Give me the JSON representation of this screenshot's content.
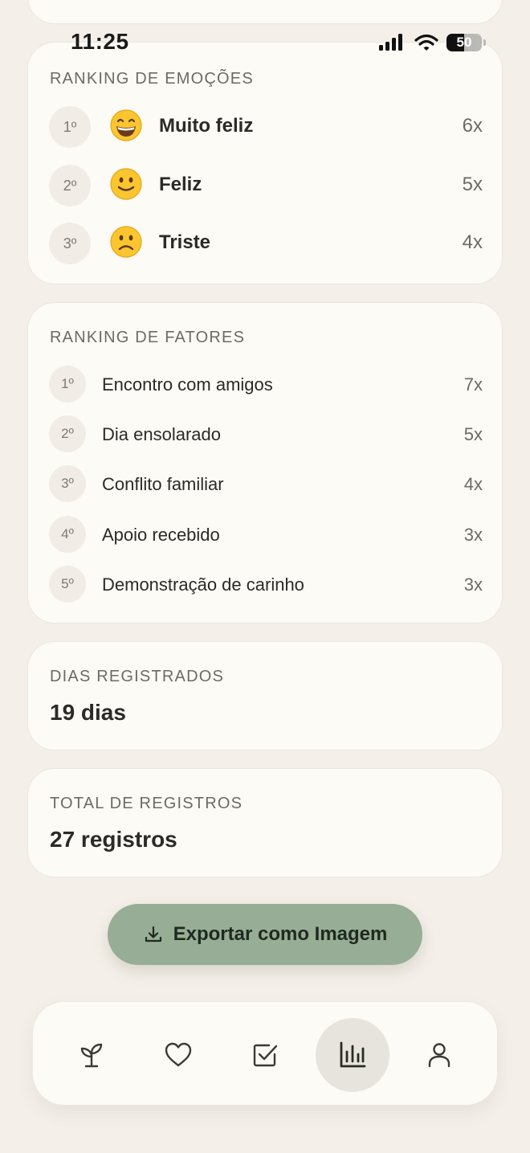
{
  "status_bar": {
    "time": "11:25",
    "battery_level": 50,
    "battery_text": "50",
    "icons": [
      "signal-icon",
      "wifi-icon",
      "battery-icon"
    ]
  },
  "emotions_card": {
    "title": "RANKING DE EMOÇÕES",
    "items": [
      {
        "rank": "1º",
        "emoji": "grinning-face",
        "label": "Muito feliz",
        "count": "6x"
      },
      {
        "rank": "2º",
        "emoji": "slightly-smiling-face",
        "label": "Feliz",
        "count": "5x"
      },
      {
        "rank": "3º",
        "emoji": "slightly-frowning-face",
        "label": "Triste",
        "count": "4x"
      }
    ]
  },
  "factors_card": {
    "title": "RANKING DE FATORES",
    "items": [
      {
        "rank": "1º",
        "label": "Encontro com amigos",
        "count": "7x"
      },
      {
        "rank": "2º",
        "label": "Dia ensolarado",
        "count": "5x"
      },
      {
        "rank": "3º",
        "label": "Conflito familiar",
        "count": "4x"
      },
      {
        "rank": "4º",
        "label": "Apoio recebido",
        "count": "3x"
      },
      {
        "rank": "5º",
        "label": "Demonstração de carinho",
        "count": "3x"
      }
    ]
  },
  "days_card": {
    "title": "DIAS REGISTRADOS",
    "value": "19 dias"
  },
  "total_card": {
    "title": "TOTAL DE REGISTROS",
    "value": "27 registros"
  },
  "export_button": {
    "label": "Exportar como Imagem",
    "icon": "download-icon"
  },
  "bottom_nav": {
    "items": [
      {
        "icon": "sprout-icon",
        "active": false
      },
      {
        "icon": "heart-icon",
        "active": false
      },
      {
        "icon": "checkbox-icon",
        "active": false
      },
      {
        "icon": "bar-chart-icon",
        "active": true
      },
      {
        "icon": "user-icon",
        "active": false
      }
    ]
  },
  "colors": {
    "background": "#f4efe9",
    "card": "#fdfbf6",
    "accent_button": "#98ad95",
    "active_nav": "#e6e4dd"
  }
}
